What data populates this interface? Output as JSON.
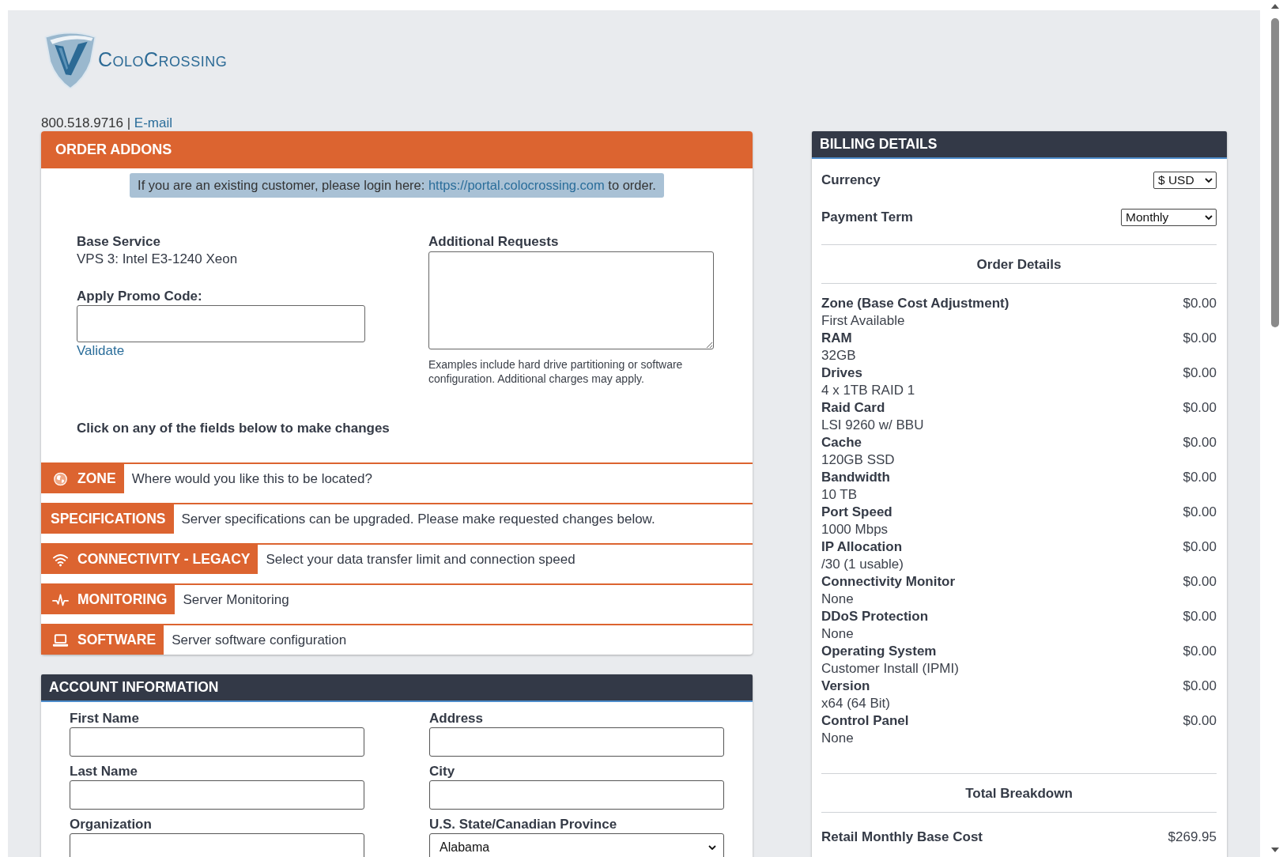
{
  "logo": {
    "text": "ColoCrossing"
  },
  "contact": {
    "phone": "800.518.9716",
    "separator": "|",
    "email_link": "E-mail"
  },
  "order_addons": {
    "title": "ORDER ADDONS",
    "notice": {
      "text": "If you are an existing customer, please login here:",
      "link": "https://portal.colocrossing.com",
      "suffix": "to order."
    },
    "base_service": {
      "label": "Base Service",
      "value": "VPS 3: Intel E3-1240 Xeon"
    },
    "promo_code": {
      "label": "Apply Promo Code:",
      "action": "Validate"
    },
    "additional_requests": {
      "label": "Additional Requests",
      "help": "Examples include hard drive partitioning or software configuration. Additional charges may apply."
    },
    "instruction": "Click on any of the fields below to make changes",
    "sections": [
      {
        "kind": "zone",
        "label": "ZONE",
        "description": "Where would you like this to be located?"
      },
      {
        "kind": "specifications",
        "label": "SPECIFICATIONS",
        "description": "Server specifications can be upgraded. Please make requested changes below."
      },
      {
        "kind": "connectivity",
        "label": "CONNECTIVITY - LEGACY",
        "description": "Select your data transfer limit and connection speed"
      },
      {
        "kind": "monitoring",
        "label": "MONITORING",
        "description": "Server Monitoring"
      },
      {
        "kind": "software",
        "label": "SOFTWARE",
        "description": "Server software configuration"
      }
    ]
  },
  "account_information": {
    "title": "ACCOUNT INFORMATION",
    "fields": [
      {
        "kind": "text",
        "label": "First Name"
      },
      {
        "kind": "text",
        "label": "Address"
      },
      {
        "kind": "text",
        "label": "Last Name"
      },
      {
        "kind": "text",
        "label": "City"
      },
      {
        "kind": "text",
        "label": "Organization"
      },
      {
        "kind": "select",
        "label": "U.S. State/Canadian Province",
        "value": "Alabama"
      }
    ]
  },
  "billing_details": {
    "title": "BILLING DETAILS",
    "currency": {
      "label": "Currency",
      "value": "$ USD"
    },
    "payment_term": {
      "label": "Payment Term",
      "value": "Monthly"
    },
    "order_details": {
      "title": "Order Details",
      "items": [
        {
          "name": "Zone (Base Cost Adjustment)",
          "detail": "First Available",
          "price": "$0.00"
        },
        {
          "name": "RAM",
          "detail": "32GB",
          "price": "$0.00"
        },
        {
          "name": "Drives",
          "detail": "4 x 1TB RAID 1",
          "price": "$0.00"
        },
        {
          "name": "Raid Card",
          "detail": "LSI 9260 w/ BBU",
          "price": "$0.00"
        },
        {
          "name": "Cache",
          "detail": "120GB SSD",
          "price": "$0.00"
        },
        {
          "name": "Bandwidth",
          "detail": "10 TB",
          "price": "$0.00"
        },
        {
          "name": "Port Speed",
          "detail": "1000 Mbps",
          "price": "$0.00"
        },
        {
          "name": "IP Allocation",
          "detail": "/30 (1 usable)",
          "price": "$0.00"
        },
        {
          "name": "Connectivity Monitor",
          "detail": "None",
          "price": "$0.00"
        },
        {
          "name": "DDoS Protection",
          "detail": "None",
          "price": "$0.00"
        },
        {
          "name": "Operating System",
          "detail": "Customer Install (IPMI)",
          "price": "$0.00"
        },
        {
          "name": "Version",
          "detail": "x64 (64 Bit)",
          "price": "$0.00"
        },
        {
          "name": "Control Panel",
          "detail": "None",
          "price": "$0.00"
        }
      ]
    },
    "total_breakdown": {
      "title": "Total Breakdown",
      "rows": [
        {
          "label": "Retail Monthly Base Cost",
          "amount": "$269.95"
        }
      ]
    }
  }
}
